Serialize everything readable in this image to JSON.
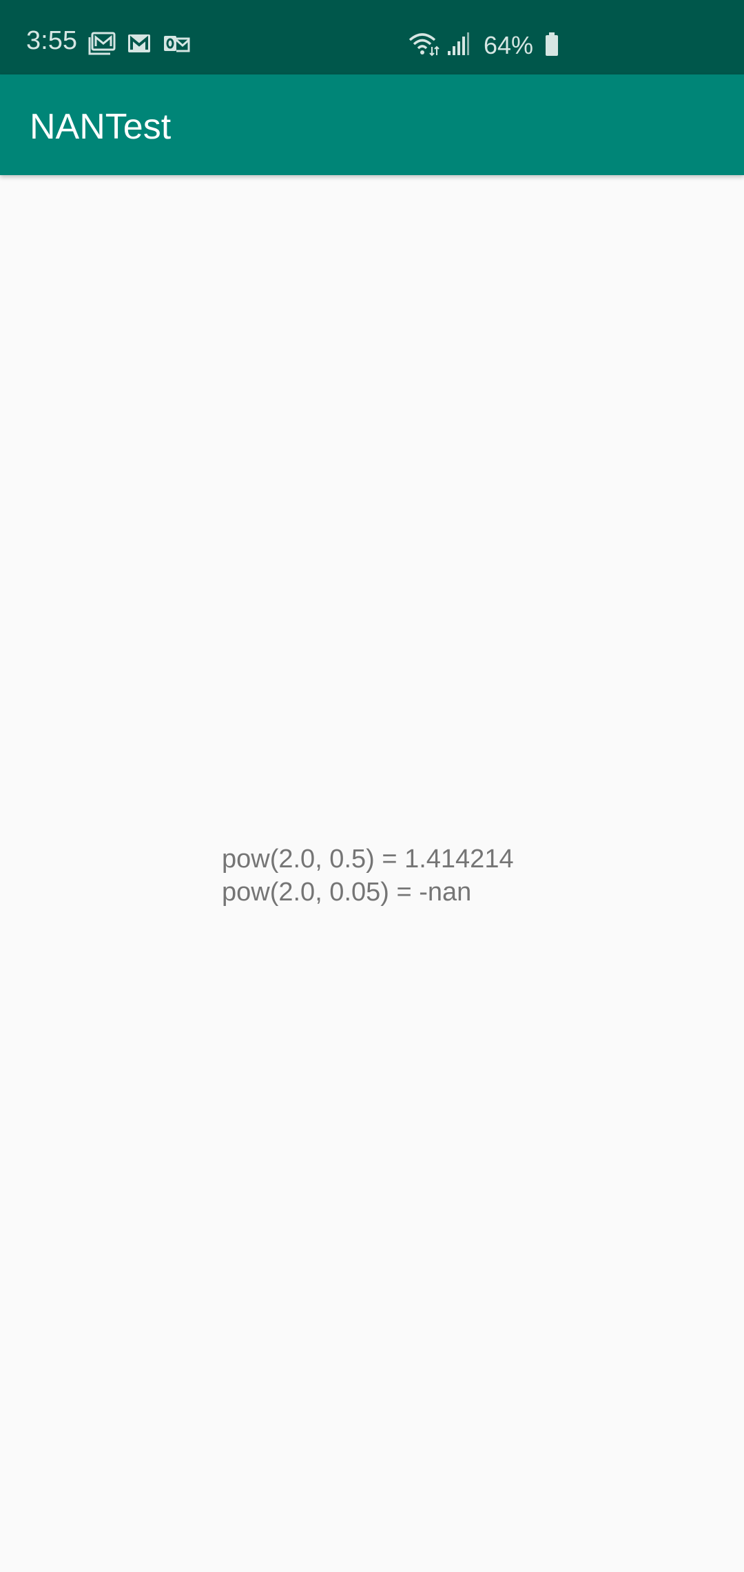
{
  "status_bar": {
    "time": "3:55",
    "notifications": [
      "gallery-mail-icon",
      "gmail-icon",
      "outlook-icon"
    ],
    "wifi": "wifi-icon",
    "signal": "signal-icon",
    "battery_percent": "64%",
    "battery": "battery-icon"
  },
  "app_bar": {
    "title": "NANTest"
  },
  "main": {
    "lines": [
      "pow(2.0, 0.5) = 1.414214",
      "pow(2.0, 0.05) = -nan"
    ]
  },
  "colors": {
    "status_bar": "#00574b",
    "app_bar": "#008577",
    "background": "#fafafa",
    "text": "#757575"
  }
}
